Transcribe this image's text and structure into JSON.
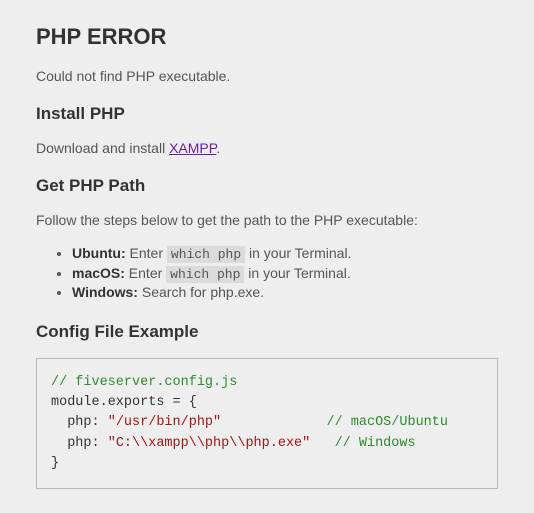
{
  "title": "PHP ERROR",
  "intro": "Could not find PHP executable.",
  "sections": {
    "install": {
      "heading": "Install PHP",
      "text_before": "Download and install ",
      "link_text": "XAMPP",
      "text_after": "."
    },
    "path": {
      "heading": "Get PHP Path",
      "intro": "Follow the steps below to get the path to the PHP executable:",
      "items": [
        {
          "os": "Ubuntu:",
          "before": " Enter ",
          "code": "which php",
          "after": " in your Terminal."
        },
        {
          "os": "macOS:",
          "before": " Enter ",
          "code": "which php",
          "after": " in your Terminal."
        },
        {
          "os": "Windows:",
          "before": " Search for php.exe.",
          "code": "",
          "after": ""
        }
      ]
    },
    "config": {
      "heading": "Config File Example",
      "code": {
        "comment_top": "// fiveserver.config.js",
        "line_open": "module.exports = {",
        "key1": "  php: ",
        "val1": "\"/usr/bin/php\"",
        "pad1": "             ",
        "comment1": "// macOS/Ubuntu",
        "key2": "  php: ",
        "val2": "\"C:\\\\xampp\\\\php\\\\php.exe\"",
        "pad2": "   ",
        "comment2": "// Windows",
        "line_close": "}"
      }
    }
  }
}
